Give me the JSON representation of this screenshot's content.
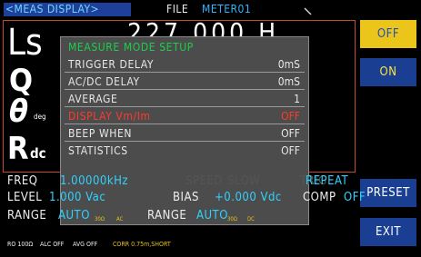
{
  "header": {
    "screen_title": "<MEAS DISPLAY>",
    "file_label": "FILE",
    "file_name": "METER01"
  },
  "measurement": {
    "param1": "Ls",
    "param2": "Q",
    "param3": "θ",
    "param3_unit": "deg",
    "param4": "R",
    "param4_sub": "dc",
    "param1_value_partial": "227 000   H"
  },
  "modal": {
    "title": "MEASURE MODE SETUP",
    "rows": [
      {
        "label": "TRIGGER DELAY",
        "value": "0mS"
      },
      {
        "label": "AC/DC DELAY",
        "value": "0mS"
      },
      {
        "label": "AVERAGE",
        "value": "1"
      },
      {
        "label": "DISPLAY Vm/Im",
        "value": "OFF"
      },
      {
        "label": "BEEP WHEN",
        "value": "OFF"
      },
      {
        "label": "STATISTICS",
        "value": "OFF"
      }
    ],
    "highlight_color": "#ff3a2a"
  },
  "sidebar": {
    "buttons": [
      {
        "label": "OFF"
      },
      {
        "label": "ON"
      },
      {
        "label": "PRESET"
      },
      {
        "label": "EXIT"
      }
    ]
  },
  "status": {
    "freq_label": "FREQ",
    "freq_value": "1.00000kHz",
    "speed_label": "SPEED",
    "speed_value": "SLOW",
    "trig_label": "TRIG",
    "trig_value": "REPEAT",
    "level_label": "LEVEL",
    "level_value": "1.000 Vac",
    "bias_label": "BIAS",
    "bias_value": "+0.000 Vdc",
    "comp_label": "COMP",
    "comp_value": "OFF",
    "range1_label": "RANGE",
    "range1_value": "AUTO",
    "range1_ohm": "30Ω",
    "range1_mode": "AC",
    "range2_label": "RANGE",
    "range2_value": "AUTO",
    "range2_ohm": "30Ω",
    "range2_mode": "DC"
  },
  "footer": {
    "ro": "RO 100Ω",
    "alc": "ALC OFF",
    "avg": "AVG OFF",
    "corr": "CORR 0.75m,SHORT"
  },
  "colors": {
    "accent_cyan": "#2fd2ff",
    "title_bg": "#1e3f9a",
    "button_yellow": "#ecc51a",
    "button_blue": "#1a3f92",
    "frame_red": "#c54a2a",
    "modal_title_green": "#19d04a"
  }
}
